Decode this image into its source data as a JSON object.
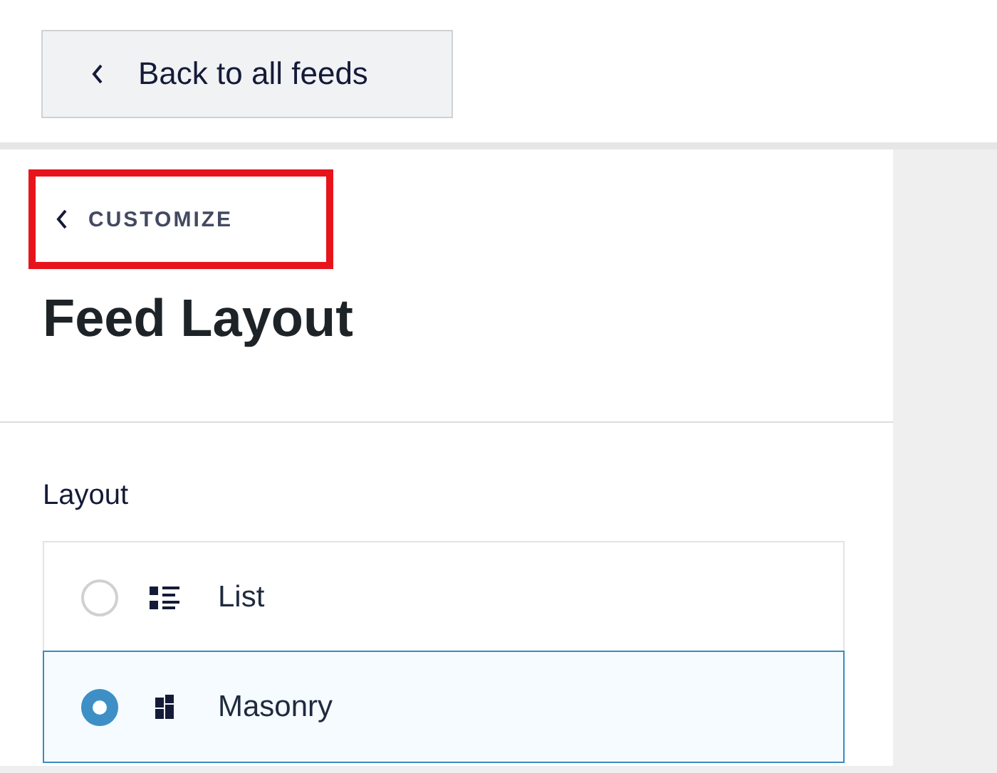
{
  "top_bar": {
    "back_button": {
      "label": "Back to all feeds"
    }
  },
  "panel": {
    "breadcrumb": {
      "label": "CUSTOMIZE",
      "highlighted": true
    },
    "title": "Feed Layout",
    "section": {
      "label": "Layout",
      "options": [
        {
          "label": "List",
          "kind": "list",
          "selected": false
        },
        {
          "label": "Masonry",
          "kind": "masonry",
          "selected": true
        }
      ]
    }
  }
}
